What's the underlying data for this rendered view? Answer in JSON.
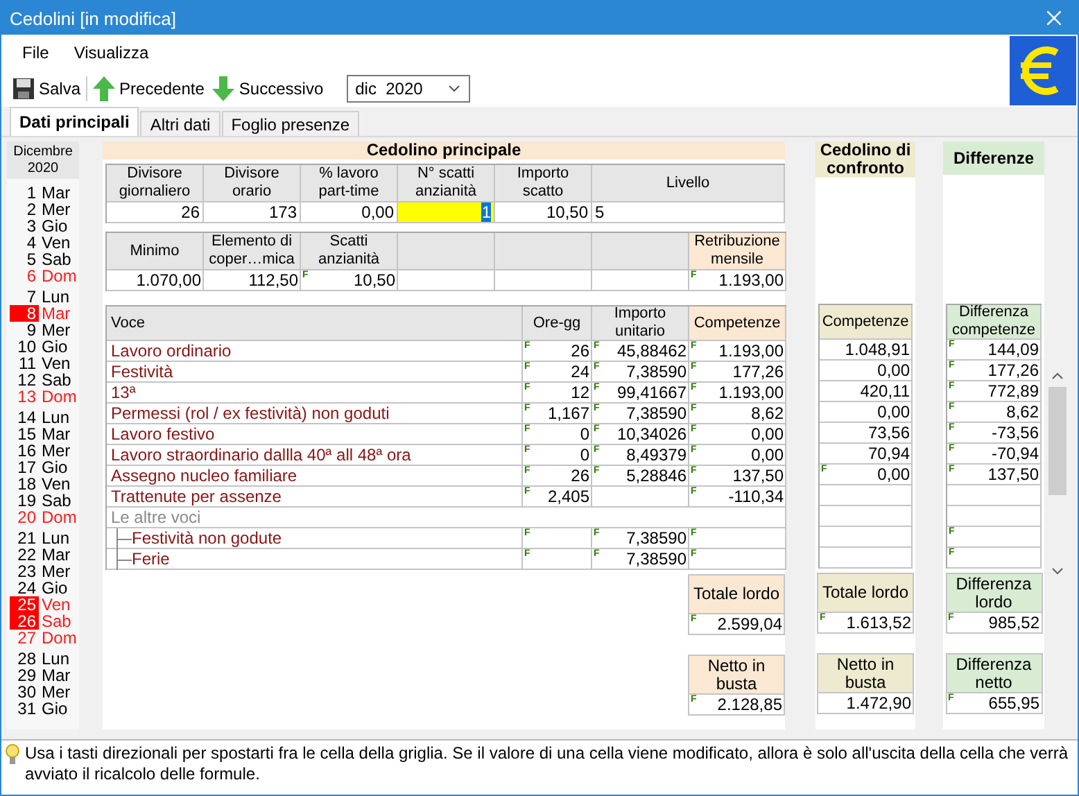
{
  "window": {
    "title": "Cedolini [in modifica]"
  },
  "menu": [
    "File",
    "Visualizza"
  ],
  "toolbar": {
    "buttons": [
      {
        "kind": "save",
        "label": "Salva"
      },
      {
        "kind": "up",
        "label": "Precedente"
      },
      {
        "kind": "down",
        "label": "Successivo"
      }
    ],
    "period": {
      "month": "dic",
      "year": "2020"
    }
  },
  "tabs": [
    {
      "label": "Dati principali",
      "selected": true
    },
    {
      "label": "Altri dati",
      "selected": false
    },
    {
      "label": "Foglio presenze",
      "selected": false
    }
  ],
  "calendar": {
    "month": "Dicembre",
    "year": "2020",
    "weeks": [
      [
        {
          "day": "1",
          "weekday": "Mar",
          "holiday": false,
          "highlighted": false
        },
        {
          "day": "2",
          "weekday": "Mer",
          "holiday": false,
          "highlighted": false
        },
        {
          "day": "3",
          "weekday": "Gio",
          "holiday": false,
          "highlighted": false
        },
        {
          "day": "4",
          "weekday": "Ven",
          "holiday": false,
          "highlighted": false
        },
        {
          "day": "5",
          "weekday": "Sab",
          "holiday": false,
          "highlighted": false
        },
        {
          "day": "6",
          "weekday": "Dom",
          "holiday": true,
          "highlighted": false
        }
      ],
      [
        {
          "day": "7",
          "weekday": "Lun",
          "holiday": false,
          "highlighted": false
        },
        {
          "day": "8",
          "weekday": "Mar",
          "holiday": true,
          "highlighted": true
        },
        {
          "day": "9",
          "weekday": "Mer",
          "holiday": false,
          "highlighted": false
        },
        {
          "day": "10",
          "weekday": "Gio",
          "holiday": false,
          "highlighted": false
        },
        {
          "day": "11",
          "weekday": "Ven",
          "holiday": false,
          "highlighted": false
        },
        {
          "day": "12",
          "weekday": "Sab",
          "holiday": false,
          "highlighted": false
        },
        {
          "day": "13",
          "weekday": "Dom",
          "holiday": true,
          "highlighted": false
        }
      ],
      [
        {
          "day": "14",
          "weekday": "Lun",
          "holiday": false,
          "highlighted": false
        },
        {
          "day": "15",
          "weekday": "Mar",
          "holiday": false,
          "highlighted": false
        },
        {
          "day": "16",
          "weekday": "Mer",
          "holiday": false,
          "highlighted": false
        },
        {
          "day": "17",
          "weekday": "Gio",
          "holiday": false,
          "highlighted": false
        },
        {
          "day": "18",
          "weekday": "Ven",
          "holiday": false,
          "highlighted": false
        },
        {
          "day": "19",
          "weekday": "Sab",
          "holiday": false,
          "highlighted": false
        },
        {
          "day": "20",
          "weekday": "Dom",
          "holiday": true,
          "highlighted": false
        }
      ],
      [
        {
          "day": "21",
          "weekday": "Lun",
          "holiday": false,
          "highlighted": false
        },
        {
          "day": "22",
          "weekday": "Mar",
          "holiday": false,
          "highlighted": false
        },
        {
          "day": "23",
          "weekday": "Mer",
          "holiday": false,
          "highlighted": false
        },
        {
          "day": "24",
          "weekday": "Gio",
          "holiday": false,
          "highlighted": false
        },
        {
          "day": "25",
          "weekday": "Ven",
          "holiday": true,
          "highlighted": true
        },
        {
          "day": "26",
          "weekday": "Sab",
          "holiday": true,
          "highlighted": true
        },
        {
          "day": "27",
          "weekday": "Dom",
          "holiday": true,
          "highlighted": false
        }
      ],
      [
        {
          "day": "28",
          "weekday": "Lun",
          "holiday": false,
          "highlighted": false
        },
        {
          "day": "29",
          "weekday": "Mar",
          "holiday": false,
          "highlighted": false
        },
        {
          "day": "30",
          "weekday": "Mer",
          "holiday": false,
          "highlighted": false
        },
        {
          "day": "31",
          "weekday": "Gio",
          "holiday": false,
          "highlighted": false
        }
      ]
    ]
  },
  "main": {
    "title": "Cedolino principale",
    "params": [
      {
        "kind": "number",
        "label": "Divisore giornaliero",
        "value": "26",
        "focused": false
      },
      {
        "kind": "number",
        "label": "Divisore orario",
        "value": "173",
        "focused": false
      },
      {
        "kind": "number",
        "label": "% lavoro part-time",
        "value": "0,00",
        "focused": false
      },
      {
        "kind": "number",
        "label": "N° scatti anzianità",
        "value": "1",
        "focused": true
      },
      {
        "kind": "number",
        "label": "Importo scatto",
        "value": "10,50",
        "focused": false
      },
      {
        "kind": "text",
        "label": "Livello",
        "value": "5",
        "focused": false
      }
    ],
    "amounts": [
      {
        "kind": "field",
        "label": "Minimo",
        "value": "1.070,00",
        "highlight": false
      },
      {
        "kind": "field",
        "label": "Elemento di coper…mica",
        "value": "112,50",
        "highlight": false
      },
      {
        "kind": "field",
        "label": "Scatti anzianità",
        "flag": "F",
        "value": "10,50",
        "highlight": false
      },
      {
        "kind": "blank"
      },
      {
        "kind": "blank"
      },
      {
        "kind": "blank"
      },
      {
        "kind": "field",
        "label": "Retribuzione mensile",
        "flag": "F",
        "value": "1.193,00",
        "highlight": true
      }
    ],
    "voci": {
      "columns": [
        "Voce",
        "Ore-gg",
        "Importo unitario",
        "Competenze"
      ],
      "rows": [
        {
          "kind": "item",
          "name": "Lavoro ordinario",
          "cells": [
            {
              "flag": "F",
              "value": "26"
            },
            {
              "flag": "F",
              "value": "45,88462"
            },
            {
              "flag": "F",
              "value": "1.193,00"
            }
          ]
        },
        {
          "kind": "item",
          "name": "Festività",
          "cells": [
            {
              "flag": "F",
              "value": "24"
            },
            {
              "flag": "F",
              "value": "7,38590"
            },
            {
              "flag": "F",
              "value": "177,26"
            }
          ]
        },
        {
          "kind": "item",
          "name": "13ª",
          "cells": [
            {
              "flag": "F",
              "value": "12"
            },
            {
              "flag": "F",
              "value": "99,41667"
            },
            {
              "flag": "F",
              "value": "1.193,00"
            }
          ]
        },
        {
          "kind": "item",
          "name": "Permessi (rol / ex festività) non goduti",
          "cells": [
            {
              "flag": "F",
              "value": "1,167"
            },
            {
              "flag": "F",
              "value": "7,38590"
            },
            {
              "flag": "F",
              "value": "8,62"
            }
          ]
        },
        {
          "kind": "item",
          "name": "Lavoro festivo",
          "cells": [
            {
              "flag": "F",
              "value": "0"
            },
            {
              "flag": "F",
              "value": "10,34026"
            },
            {
              "flag": "F",
              "value": "0,00"
            }
          ]
        },
        {
          "kind": "item",
          "name": "Lavoro straordinario dallla 40ª all 48ª ora",
          "cells": [
            {
              "flag": "F",
              "value": "0"
            },
            {
              "flag": "F",
              "value": "8,49379"
            },
            {
              "flag": "F",
              "value": "0,00"
            }
          ]
        },
        {
          "kind": "item",
          "name": "Assegno nucleo familiare",
          "cells": [
            {
              "flag": "F",
              "value": "26"
            },
            {
              "flag": "F",
              "value": "5,28846"
            },
            {
              "flag": "F",
              "value": "137,50"
            }
          ]
        },
        {
          "kind": "item",
          "name": "Trattenute per assenze",
          "cells": [
            {
              "flag": "F",
              "value": "2,405"
            },
            {},
            {
              "flag": "F",
              "value": "-110,34"
            }
          ]
        },
        {
          "kind": "group",
          "name": "Le altre voci",
          "children": [
            {
              "kind": "item",
              "name": "Festività non godute",
              "cells": [
                {
                  "flag": "F"
                },
                {
                  "flag": "F",
                  "value": "7,38590"
                },
                {
                  "flag": "F"
                }
              ]
            },
            {
              "kind": "item",
              "name": "Ferie",
              "cells": [
                {
                  "flag": "F"
                },
                {
                  "flag": "F",
                  "value": "7,38590"
                },
                {
                  "flag": "F"
                }
              ]
            }
          ]
        }
      ]
    },
    "totals": [
      {
        "label": "Totale lordo",
        "flag": "F",
        "value": "2.599,04"
      },
      {
        "label": "Netto in busta",
        "flag": "F",
        "value": "2.128,85"
      }
    ]
  },
  "confronto": {
    "title": "Cedolino di confronto",
    "column": "Competenze",
    "cells": [
      {
        "value": "1.048,91"
      },
      {
        "value": "0,00"
      },
      {
        "value": "420,11"
      },
      {
        "value": "0,00"
      },
      {
        "value": "73,56"
      },
      {
        "value": "70,94"
      },
      {
        "flag": "F",
        "value": "0,00"
      },
      {},
      {},
      {},
      {}
    ],
    "totals": [
      {
        "label": "Totale lordo",
        "flag": "F",
        "value": "1.613,52"
      },
      {
        "label": "Netto in busta",
        "value": "1.472,90"
      }
    ]
  },
  "differenze": {
    "title": "Differenze",
    "column": "Differenza competenze",
    "cells": [
      {
        "flag": "F",
        "value": "144,09"
      },
      {
        "flag": "F",
        "value": "177,26"
      },
      {
        "flag": "F",
        "value": "772,89"
      },
      {
        "flag": "F",
        "value": "8,62"
      },
      {
        "flag": "F",
        "value": "-73,56"
      },
      {
        "flag": "F",
        "value": "-70,94"
      },
      {
        "flag": "F",
        "value": "137,50"
      },
      {},
      {},
      {
        "flag": "F"
      },
      {
        "flag": "F"
      }
    ],
    "totals": [
      {
        "label": "Differenza lordo",
        "flag": "F",
        "value": "985,52"
      },
      {
        "label": "Differenza netto",
        "flag": "F",
        "value": "655,95"
      }
    ]
  },
  "hint": "Usa i tasti direzionali per spostarti fra le cella della griglia. Se il valore di una cella viene modificato, allora è solo all'uscita della cella che verrà avviato il ricalcolo delle formule."
}
